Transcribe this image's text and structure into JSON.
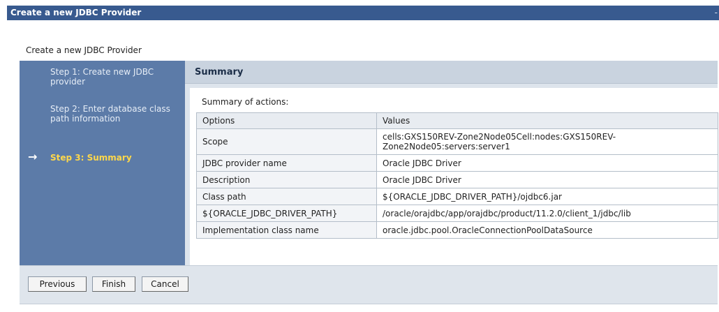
{
  "window": {
    "title": "Create a new JDBC Provider",
    "collapse_glyph": "-"
  },
  "page": {
    "heading": "Create a new JDBC Provider"
  },
  "steps": [
    {
      "label": "Step 1: Create new JDBC provider",
      "current": false
    },
    {
      "label": "Step 2: Enter database class path information",
      "current": false
    },
    {
      "label": "Step 3: Summary",
      "current": true
    }
  ],
  "current_step_arrow": "→",
  "summary": {
    "title": "Summary",
    "actions_label": "Summary of actions:",
    "columns": [
      "Options",
      "Values"
    ],
    "rows": [
      {
        "option": "Scope",
        "value": "cells:GXS150REV-Zone2Node05Cell:nodes:GXS150REV-Zone2Node05:servers:server1"
      },
      {
        "option": "JDBC provider name",
        "value": "Oracle JDBC Driver"
      },
      {
        "option": "Description",
        "value": "Oracle JDBC Driver"
      },
      {
        "option": "Class path",
        "value": "${ORACLE_JDBC_DRIVER_PATH}/ojdbc6.jar"
      },
      {
        "option": "${ORACLE_JDBC_DRIVER_PATH}",
        "value": "/oracle/orajdbc/app/orajdbc/product/11.2.0/client_1/jdbc/lib"
      },
      {
        "option": "Implementation class name",
        "value": "oracle.jdbc.pool.OracleConnectionPoolDataSource"
      }
    ]
  },
  "buttons": {
    "previous": "Previous",
    "finish": "Finish",
    "cancel": "Cancel"
  },
  "colors": {
    "titlebar": "#385a8f",
    "steps_panel": "#5c7ba8",
    "current_step": "#ffd84a",
    "content_bg": "#dde4ec",
    "header_bg": "#c9d3df"
  }
}
